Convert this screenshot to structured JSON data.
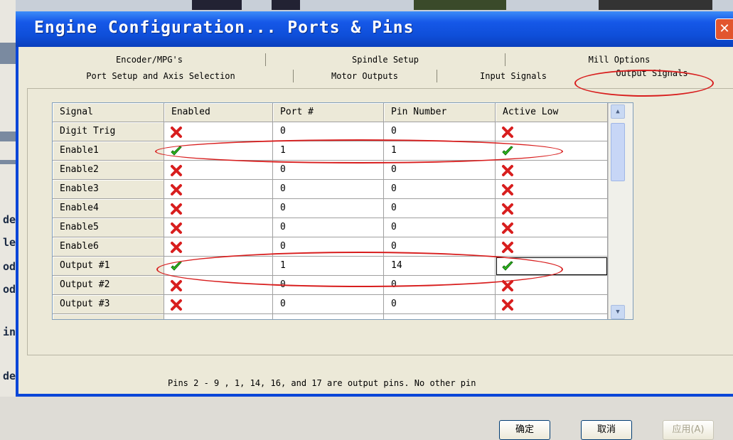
{
  "window": {
    "title": "Engine Configuration... Ports & Pins",
    "close_glyph": "✕"
  },
  "background": {
    "left_glyphs": [
      "de",
      "le",
      "od",
      "od",
      "in",
      "de"
    ]
  },
  "tabs": {
    "row1": [
      "Encoder/MPG's",
      "Spindle Setup",
      "Mill Options"
    ],
    "row2": [
      "Port Setup and Axis Selection",
      "Motor Outputs",
      "Input Signals",
      "Output Signals"
    ],
    "active": "Output Signals"
  },
  "grid": {
    "headers": [
      "Signal",
      "Enabled",
      "Port #",
      "Pin Number",
      "Active Low"
    ],
    "rows": [
      {
        "signal": "Digit  Trig",
        "enabled": false,
        "port": "0",
        "pin": "0",
        "active_low": false
      },
      {
        "signal": "Enable1",
        "enabled": true,
        "port": "1",
        "pin": "1",
        "active_low": true
      },
      {
        "signal": "Enable2",
        "enabled": false,
        "port": "0",
        "pin": "0",
        "active_low": false
      },
      {
        "signal": "Enable3",
        "enabled": false,
        "port": "0",
        "pin": "0",
        "active_low": false
      },
      {
        "signal": "Enable4",
        "enabled": false,
        "port": "0",
        "pin": "0",
        "active_low": false
      },
      {
        "signal": "Enable5",
        "enabled": false,
        "port": "0",
        "pin": "0",
        "active_low": false
      },
      {
        "signal": "Enable6",
        "enabled": false,
        "port": "0",
        "pin": "0",
        "active_low": false
      },
      {
        "signal": "Output #1",
        "enabled": true,
        "port": "1",
        "pin": "14",
        "active_low": true
      },
      {
        "signal": "Output #2",
        "enabled": false,
        "port": "0",
        "pin": "0",
        "active_low": false
      },
      {
        "signal": "Output #3",
        "enabled": false,
        "port": "0",
        "pin": "0",
        "active_low": false
      },
      {
        "signal": "",
        "enabled": false,
        "port": "",
        "pin": "",
        "active_low": false
      }
    ],
    "scroll_up_glyph": "▲",
    "scroll_down_glyph": "▼"
  },
  "icons": {
    "enabled_true": "green-check-icon",
    "enabled_false": "red-x-icon"
  },
  "colors": {
    "titlebar": "#0a46d8",
    "annotation": "#d81e1e",
    "check": "#2fbf1f",
    "cross": "#d81e1e"
  },
  "note": "Pins 2 - 9 , 1, 14, 16, and 17 are output pins. No  other pin",
  "buttons": {
    "ok": "确定",
    "cancel": "取消",
    "apply": "应用(A)"
  }
}
